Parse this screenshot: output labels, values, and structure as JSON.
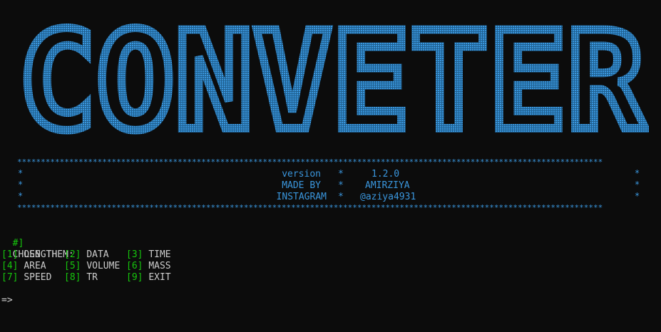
{
  "banner": {
    "text": "CONVETER",
    "color": "#3a96dd"
  },
  "stars": "****************************************************************************************************************************",
  "info": [
    {
      "label": "version",
      "value": "1.2.0"
    },
    {
      "label": "MADE BY",
      "value": "AMIRZIYA"
    },
    {
      "label": "INSTAGRAM",
      "value": "@aziya4931"
    }
  ],
  "separator": "*",
  "prompt_prefix": "#]",
  "prompt_text": "CHOSS THEM:",
  "menu": [
    [
      {
        "num": "[1]",
        "label": "LENGTH"
      },
      {
        "num": "[2]",
        "label": "DATA"
      },
      {
        "num": "[3]",
        "label": "TIME"
      }
    ],
    [
      {
        "num": "[4]",
        "label": "AREA"
      },
      {
        "num": "[5]",
        "label": "VOLUME"
      },
      {
        "num": "[6]",
        "label": "MASS"
      }
    ],
    [
      {
        "num": "[7]",
        "label": "SPEED"
      },
      {
        "num": "[8]",
        "label": "TR"
      },
      {
        "num": "[9]",
        "label": "EXIT"
      }
    ]
  ],
  "input_prompt": "=>",
  "colors": {
    "accent": "#3a96dd",
    "green": "#16c60c",
    "text": "#cccccc",
    "background": "#0c0c0c"
  }
}
